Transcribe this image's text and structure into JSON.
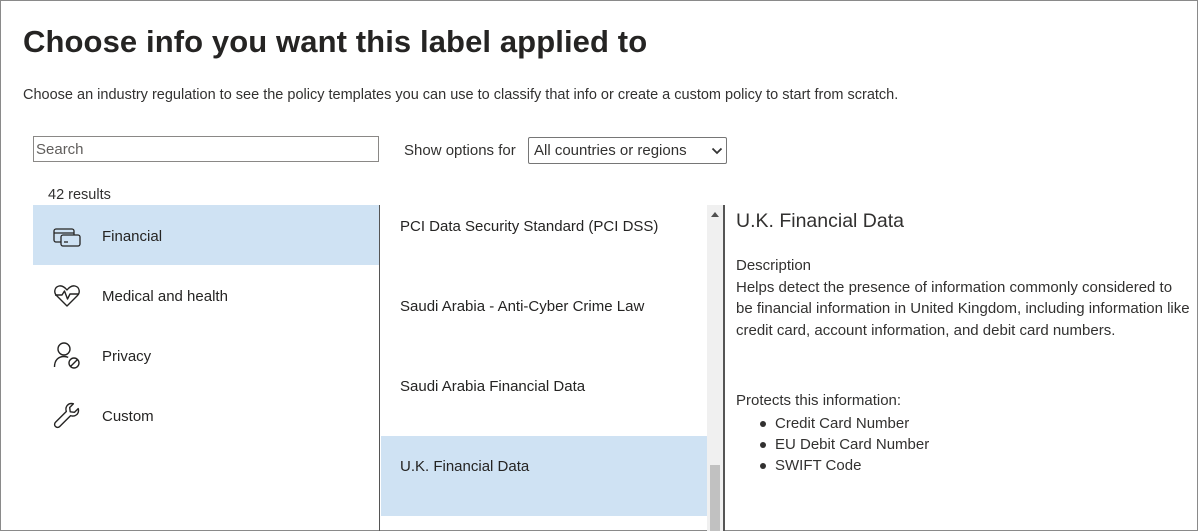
{
  "header": {
    "title": "Choose info you want this label applied to",
    "subtitle": "Choose an industry regulation to see the policy templates you can use to classify that info or create a custom policy to start from scratch."
  },
  "filters": {
    "search_placeholder": "Search",
    "search_value": "",
    "show_options_label": "Show options for",
    "region_selected": "All countries or regions"
  },
  "results_count": "42 results",
  "categories": [
    {
      "label": "Financial",
      "icon": "credit-card-icon",
      "selected": true
    },
    {
      "label": "Medical and health",
      "icon": "heart-pulse-icon",
      "selected": false
    },
    {
      "label": "Privacy",
      "icon": "person-blocked-icon",
      "selected": false
    },
    {
      "label": "Custom",
      "icon": "wrench-icon",
      "selected": false
    }
  ],
  "templates": [
    {
      "label": "PCI Data Security Standard (PCI DSS)",
      "selected": false
    },
    {
      "label": "Saudi Arabia - Anti-Cyber Crime Law",
      "selected": false
    },
    {
      "label": "Saudi Arabia Financial Data",
      "selected": false
    },
    {
      "label": "U.K. Financial Data",
      "selected": true
    }
  ],
  "detail": {
    "title": "U.K. Financial Data",
    "description_heading": "Description",
    "description": "Helps detect the presence of information commonly considered to be financial information in United Kingdom, including information like credit card, account information, and debit card numbers.",
    "protects_heading": "Protects this information:",
    "protects": [
      "Credit Card Number",
      "EU Debit Card Number",
      "SWIFT Code"
    ]
  },
  "colors": {
    "selected_bg": "#cfe2f3",
    "text": "#323130",
    "title_text": "#252423"
  }
}
